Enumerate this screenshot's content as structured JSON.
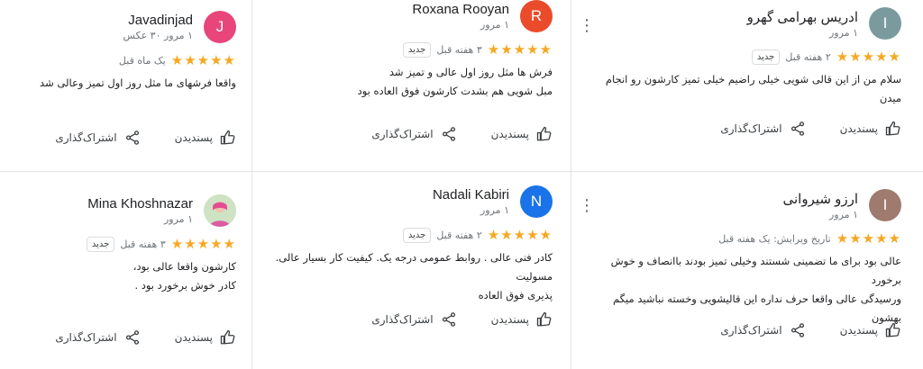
{
  "colors": {
    "star": "#f5a823",
    "avatar_j": "#e8457a",
    "avatar_r": "#ea4b2b",
    "avatar_n": "#1a73e8",
    "avatar_i1": "#7a9a9e",
    "avatar_i2": "#9e7b6e"
  },
  "reviews": [
    {
      "name": "Javadinjad",
      "initial": "J",
      "meta": "۱ مرور ۳۰ عکس",
      "stars": "★★★★★",
      "when": "یک ماه قبل",
      "badge": "",
      "text": "واقعا فرشهای ما مثل روز اول تمیز وعالی شد",
      "like": "پسندیدن",
      "share": "اشتراک‌گذاری"
    },
    {
      "name": "Roxana Rooyan",
      "initial": "R",
      "meta": "۱ مرور",
      "stars": "★★★★★",
      "when": "۳ هفته قبل",
      "badge": "جدید",
      "text": "فرش ها مثل روز اول عالی و تمیز شد\nمبل شویی هم بشدت کارشون فوق العاده بود",
      "like": "پسندیدن",
      "share": "اشتراک‌گذاری"
    },
    {
      "name": "ادریس بهرامی گهرو",
      "initial": "I",
      "meta": "۱ مرور",
      "stars": "★★★★★",
      "when": "۲ هفته قبل",
      "badge": "جدید",
      "text": "سلام من از این قالی شویی خیلی راضیم خیلی تمیز کارشون رو انجام میدن",
      "like": "پسندیدن",
      "share": "اشتراک‌گذاری"
    },
    {
      "name": "Mina Khoshnazar",
      "meta": "۱ مرور",
      "stars": "★★★★★",
      "when": "۳ هفته قبل",
      "badge": "جدید",
      "text": "کارشون واقعا عالی بود،\nکادر خوش برخورد بود .",
      "like": "پسندیدن",
      "share": "اشتراک‌گذاری"
    },
    {
      "name": "Nadali Kabiri",
      "initial": "N",
      "meta": "۱ مرور",
      "stars": "★★★★★",
      "when": "۲ هفته قبل",
      "badge": "جدید",
      "text": "کادر فنی عالی . روابط عمومی درجه یک. کیفیت کار بسیار عالی. مسولیت\nپذیری فوق العاده",
      "like": "پسندیدن",
      "share": "اشتراک‌گذاری"
    },
    {
      "name": "ارزو شیروانی",
      "initial": "I",
      "meta": "۱ مرور",
      "stars": "★★★★★",
      "when": "تاریخ ویرایش: یک هفته قبل",
      "badge": "",
      "text": "عالی بود برای ما تضمینی شستند وخیلی تمیز بودند باانصاف و خوش برخورد\nورسیدگی عالی واقعا حرف نداره این قالیشویی وخسته نباشید میگم بهشون",
      "like": "پسندیدن",
      "share": "اشتراک‌گذاری"
    }
  ]
}
